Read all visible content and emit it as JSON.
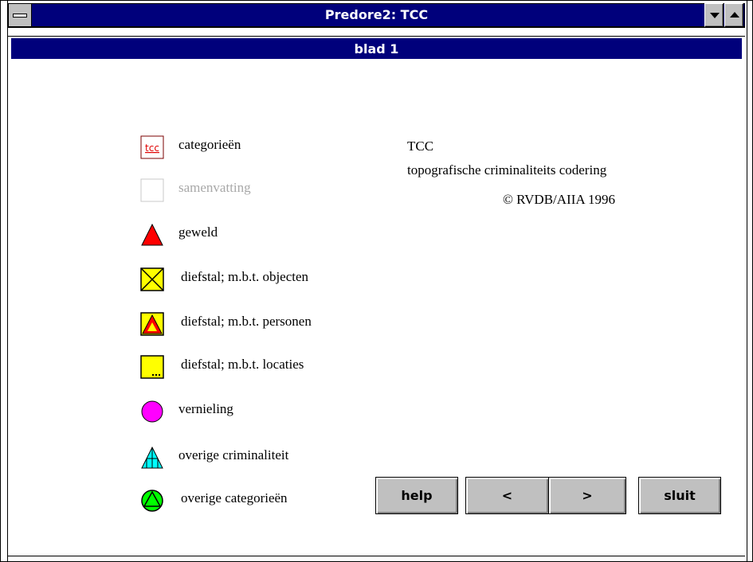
{
  "window": {
    "title": "Predore2: TCC",
    "sheet_title": "blad 1"
  },
  "legend": {
    "items": [
      {
        "label": "categorieën",
        "icon": "tcc-categories-icon",
        "icon_text": "tcc",
        "enabled": true
      },
      {
        "label": "samenvatting",
        "icon": "empty-summary-icon",
        "enabled": false
      },
      {
        "label": "geweld",
        "icon": "red-triangle-icon",
        "enabled": true
      },
      {
        "label": "diefstal; m.b.t. objecten",
        "icon": "yellow-square-cross-icon",
        "enabled": true
      },
      {
        "label": "diefstal; m.b.t. personen",
        "icon": "yellow-square-triangle-icon",
        "enabled": true
      },
      {
        "label": "diefstal; m.b.t. locaties",
        "icon": "yellow-square-dots-icon",
        "enabled": true
      },
      {
        "label": "vernieling",
        "icon": "magenta-circle-icon",
        "enabled": true
      },
      {
        "label": "overige criminaliteit",
        "icon": "cyan-triangle-icon",
        "enabled": true
      },
      {
        "label": "overige categorieën",
        "icon": "green-circle-triangle-icon",
        "enabled": true
      }
    ]
  },
  "info": {
    "line1": "TCC",
    "line2": "topografische criminaliteits codering",
    "copyright": "© RVDB/AIIA 1996"
  },
  "buttons": {
    "help": "help",
    "prev": "<",
    "next": ">",
    "close": "sluit"
  },
  "colors": {
    "titlebar": "#00007b",
    "button_face": "#c0c0c0",
    "geweld": "#ff0000",
    "diefstal": "#ffff00",
    "vernieling": "#ff00ff",
    "overige_criminaliteit": "#00ffff",
    "overige_categorieen": "#00ff00"
  }
}
